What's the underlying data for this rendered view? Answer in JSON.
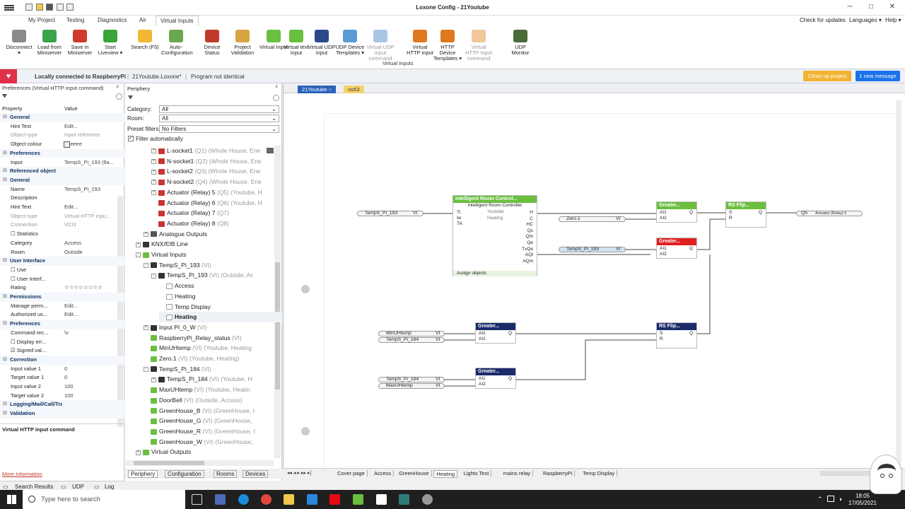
{
  "window": {
    "title": "Loxone Config - 21Youtube",
    "controls": [
      "─",
      "□",
      "✕"
    ]
  },
  "menu": {
    "tabs": [
      "My Project",
      "Testing",
      "Diagnostics",
      "Air",
      "Virtual Inputs"
    ],
    "active_tab": "Virtual Inputs",
    "right": [
      "Check for updates",
      "Languages ▾",
      "Help ▾"
    ]
  },
  "ribbon": {
    "buttons": [
      {
        "name": "disconnect",
        "label": "Disconnect ▾",
        "color": "#8a8a8a"
      },
      {
        "name": "load",
        "label": "Load from Miniserver",
        "color": "#3ba34a"
      },
      {
        "name": "save",
        "label": "Save in Miniserver",
        "color": "#d0392b"
      },
      {
        "name": "liveview",
        "label": "Start Liveview ▾",
        "color": "#3aa43a"
      },
      {
        "name": "search",
        "label": "Search (F5)",
        "color": "#f2b733"
      },
      {
        "name": "autoconfig",
        "label": "Auto-Configuration",
        "color": "#6aa84f"
      },
      {
        "name": "devstatus",
        "label": "Device Status",
        "color": "#c0392b"
      },
      {
        "name": "validation",
        "label": "Project Validation",
        "color": "#d9a441"
      },
      {
        "name": "vinput",
        "label": "Virtual Input",
        "color": "#6abf3f"
      },
      {
        "name": "vtextinput",
        "label": "Virtual text input",
        "color": "#6abf3f"
      },
      {
        "name": "vudpinput",
        "label": "Virtual UDP input",
        "color": "#2b4a8b"
      },
      {
        "name": "udptemplates",
        "label": "UDP Device Templates ▾",
        "color": "#5b9bd5"
      },
      {
        "name": "vudpcmd",
        "label": "Virtual UDP input command",
        "color": "#a9c4e4",
        "disabled": true
      },
      {
        "name": "vhttp",
        "label": "Virtual HTTP input",
        "color": "#e0781e"
      },
      {
        "name": "httptemplates",
        "label": "HTTP Device Templates ▾",
        "color": "#e0781e"
      },
      {
        "name": "vhttpcmd",
        "label": "Virtual HTTP input command",
        "color": "#f0c79a",
        "disabled": true
      },
      {
        "name": "udpmonitor",
        "label": "UDP Monitor",
        "color": "#4a6a3a"
      }
    ],
    "group_label": "Virtual Inputs"
  },
  "status": {
    "connection": "Locally connected to RaspberryPi",
    "file": "21Youtube.Loxone*",
    "program": "Program not identical",
    "cleanup": "Clean up project",
    "messages": "1 new message"
  },
  "props": {
    "title": "Preferences (Virtual HTTP input command)",
    "col_property": "Property",
    "col_value": "Value",
    "rows": [
      {
        "t": "s",
        "n": "General"
      },
      {
        "n": "Hint Text",
        "v": "Edit..."
      },
      {
        "n": "Object type",
        "v": "Input reference",
        "d": true
      },
      {
        "n": "Object colour",
        "v": "eeeeee"
      },
      {
        "t": "s",
        "n": "Preferences"
      },
      {
        "n": "Input",
        "v": "TempS_Pi_193 (fla..."
      },
      {
        "t": "s",
        "n": "Referenced object"
      },
      {
        "t": "s",
        "n": "General"
      },
      {
        "n": "Name",
        "v": "TempS_Pi_193"
      },
      {
        "n": "Description",
        "v": ""
      },
      {
        "n": "Hint Text",
        "v": "Edit..."
      },
      {
        "n": "Object type",
        "v": "Virtual HTTP inpu...",
        "d": true
      },
      {
        "n": "Connection",
        "v": "VCI3",
        "d": true
      },
      {
        "n": "☐ Statistics",
        "v": ""
      },
      {
        "n": "Category",
        "v": "Access"
      },
      {
        "n": "Room",
        "v": "Outside"
      },
      {
        "t": "s",
        "n": "User Interface"
      },
      {
        "n": "☐ Use",
        "v": ""
      },
      {
        "n": "☐ User Interf...",
        "v": ""
      },
      {
        "n": "Rating",
        "v": "☆☆☆☆☆☆☆☆"
      },
      {
        "t": "s",
        "n": "Permissions"
      },
      {
        "n": "Manage perm...",
        "v": "Edit..."
      },
      {
        "n": "Authorized us...",
        "v": "Edit..."
      },
      {
        "t": "s",
        "n": "Preferences"
      },
      {
        "n": "Command rec...",
        "v": "\\v"
      },
      {
        "n": "☐ Display err...",
        "v": ""
      },
      {
        "n": "☑ Signed val...",
        "v": ""
      },
      {
        "t": "s",
        "n": "Correction"
      },
      {
        "n": "Input value 1",
        "v": "0"
      },
      {
        "n": "Target value 1",
        "v": "0"
      },
      {
        "n": "Input value 2",
        "v": "100"
      },
      {
        "n": "Target value 2",
        "v": "100"
      },
      {
        "t": "s",
        "n": "Logging/Mail/Call/Track"
      },
      {
        "t": "s",
        "n": "Validation"
      }
    ],
    "description": "Virtual HTTP input command",
    "more_info": "More Information"
  },
  "periphery": {
    "title": "Periphery",
    "category_label": "Category:",
    "category_value": "All",
    "room_label": "Room:",
    "room_value": "All",
    "preset_label": "Preset filters",
    "preset_value": "No Filters",
    "filter_auto": "Filter automatically",
    "tree": [
      {
        "i": 3,
        "e": "+",
        "c": "#c33",
        "t": "L-socket1",
        "s": " (Q1) (Whole House, Ene"
      },
      {
        "i": 3,
        "e": "+",
        "c": "#c33",
        "t": "N-socket1",
        "s": " (Q2) (Whole House, Ene"
      },
      {
        "i": 3,
        "e": "+",
        "c": "#c33",
        "t": "L-socket2",
        "s": " (Q3) (Whole House, Ene"
      },
      {
        "i": 3,
        "e": "+",
        "c": "#c33",
        "t": "N-socket2",
        "s": " (Q4) (Whole House, Ene"
      },
      {
        "i": 3,
        "e": "+",
        "c": "#c33",
        "t": "Actuator (Relay) 5",
        "s": " (Q5) (Youtube, H"
      },
      {
        "i": 3,
        "e": "",
        "c": "#c33",
        "t": "Actuator (Relay) 6",
        "s": " (Q6) (Youtube, H"
      },
      {
        "i": 3,
        "e": "",
        "c": "#c33",
        "t": "Actuator (Relay) 7",
        "s": " (Q7)"
      },
      {
        "i": 3,
        "e": "",
        "c": "#c33",
        "t": "Actuator (Relay) 8",
        "s": " (Q8)"
      },
      {
        "i": 2,
        "e": "+",
        "c": "#555",
        "t": "Analogue Outputs",
        "s": ""
      },
      {
        "i": 1,
        "e": "+",
        "c": "#333",
        "t": "KNX/EIB Line",
        "s": ""
      },
      {
        "i": 1,
        "e": "-",
        "c": "#6abf3f",
        "t": "Virtual Inputs",
        "s": ""
      },
      {
        "i": 2,
        "e": "-",
        "c": "#333",
        "t": "TempS_Pi_193",
        "s": " (VI)"
      },
      {
        "i": 3,
        "e": "-",
        "c": "#333",
        "t": "TempS_Pi_193",
        "s": " (VI) (Outside, Ac"
      },
      {
        "i": 4,
        "e": "",
        "c": "#fff",
        "t": "Access",
        "s": ""
      },
      {
        "i": 4,
        "e": "",
        "c": "#fff",
        "t": "Heating",
        "s": ""
      },
      {
        "i": 4,
        "e": "",
        "c": "#fff",
        "t": "Temp Display",
        "s": ""
      },
      {
        "i": 4,
        "e": "",
        "c": "#fff",
        "t": "Heating",
        "s": "",
        "b": true
      },
      {
        "i": 2,
        "e": "+",
        "c": "#333",
        "t": "Input PI_0_W",
        "s": " (VI)"
      },
      {
        "i": 2,
        "e": "",
        "c": "#6abf3f",
        "t": "RaspberryPi_Relay_status",
        "s": " (VI)"
      },
      {
        "i": 2,
        "e": "",
        "c": "#6abf3f",
        "t": "MinUHtemp",
        "s": " (VI) (Youtube, Heating"
      },
      {
        "i": 2,
        "e": "",
        "c": "#6abf3f",
        "t": "Zero.1",
        "s": " (VI) (Youtube, Heating)"
      },
      {
        "i": 2,
        "e": "-",
        "c": "#333",
        "t": "TempS_Pi_184",
        "s": " (VI)"
      },
      {
        "i": 3,
        "e": "+",
        "c": "#333",
        "t": "TempS_Pi_184",
        "s": " (VI) (Youtube, H"
      },
      {
        "i": 2,
        "e": "",
        "c": "#6abf3f",
        "t": "MaxUHtemp",
        "s": " (VI) (Youtube, Heatin"
      },
      {
        "i": 2,
        "e": "",
        "c": "#6abf3f",
        "t": "DoorBell",
        "s": " (VI) (Outside, Access)"
      },
      {
        "i": 2,
        "e": "",
        "c": "#6abf3f",
        "t": "GreenHouse_B",
        "s": " (VI) (GreenHouse, I"
      },
      {
        "i": 2,
        "e": "",
        "c": "#6abf3f",
        "t": "GreenHouse_G",
        "s": " (VI) (GreenHouse,"
      },
      {
        "i": 2,
        "e": "",
        "c": "#6abf3f",
        "t": "GreenHouse_R",
        "s": " (VI) (GreenHouse, I"
      },
      {
        "i": 2,
        "e": "",
        "c": "#6abf3f",
        "t": "GreenHouse_W",
        "s": " (VI) (GreenHouse,"
      },
      {
        "i": 1,
        "e": "+",
        "c": "#6abf3f",
        "t": "Virtual Outputs",
        "s": ""
      }
    ],
    "bottom_tabs": [
      "Periphery",
      "Configuration",
      "Rooms",
      "Devices"
    ]
  },
  "left_bottom_tabs": [
    "Search Results",
    "UDP",
    "Log"
  ],
  "doc_tabs": [
    "21Youtube",
    "no53"
  ],
  "canvas": {
    "irc": {
      "title": "Intelligent Room Control...",
      "subtitle": "Intelligent Room Controller",
      "room": "Youtube",
      "cat": "Heating",
      "inputs": [
        "Ti",
        "Iw",
        "TA"
      ],
      "outputs": [
        "H",
        "C",
        "HC",
        "Qs",
        "Qm",
        "Qe",
        "TxQe",
        "AQt",
        "AQm"
      ],
      "assign": "Assign objects"
    },
    "greater1": {
      "title": "Greater...",
      "in": [
        "AI1",
        "AI2"
      ],
      "out": "Q"
    },
    "greater2": {
      "title": "Greater...",
      "in": [
        "AI1",
        "AI2"
      ],
      "out": "Q"
    },
    "greater3": {
      "title": "Greater...",
      "in": [
        "AI1",
        "AI2"
      ],
      "out": "Q"
    },
    "greater4": {
      "title": "Greater...",
      "in": [
        "AI1",
        "AI2"
      ],
      "out": "Q"
    },
    "rs1": {
      "title": "RS Flip...",
      "in": [
        "S",
        "R"
      ],
      "out": "Q"
    },
    "rs2": {
      "title": "RS Flip...",
      "in": [
        "S",
        "R"
      ],
      "out": "Q"
    },
    "inputs": {
      "temp193a": {
        "name": "TempS_Pi_193",
        "tag": "VI"
      },
      "zero": {
        "name": "Zero.1",
        "tag": "VI"
      },
      "temp193b": {
        "name": "TempS_Pi_193",
        "tag": "VI"
      },
      "minuh": {
        "name": "MinUHtemp",
        "tag": "VI"
      },
      "temp184a": {
        "name": "TempS_Pi_184",
        "tag": "VI"
      },
      "temp184b": {
        "name": "TempS_Pi_184",
        "tag": "VI"
      },
      "maxuh": {
        "name": "MaxUHtemp",
        "tag": "VI"
      }
    },
    "output": {
      "tag": "Q5",
      "name": "Actuator (Relay) 5"
    },
    "page_tabs": [
      "Cover page",
      "Access",
      "GreenHouse",
      "Heating",
      "Lights Test",
      "mains relay",
      "RaspberryPi",
      "Temp Display"
    ],
    "active_page": "Heating"
  },
  "taskbar": {
    "search_placeholder": "Type here to search",
    "time": "18:05",
    "date": "17/05/2021"
  }
}
